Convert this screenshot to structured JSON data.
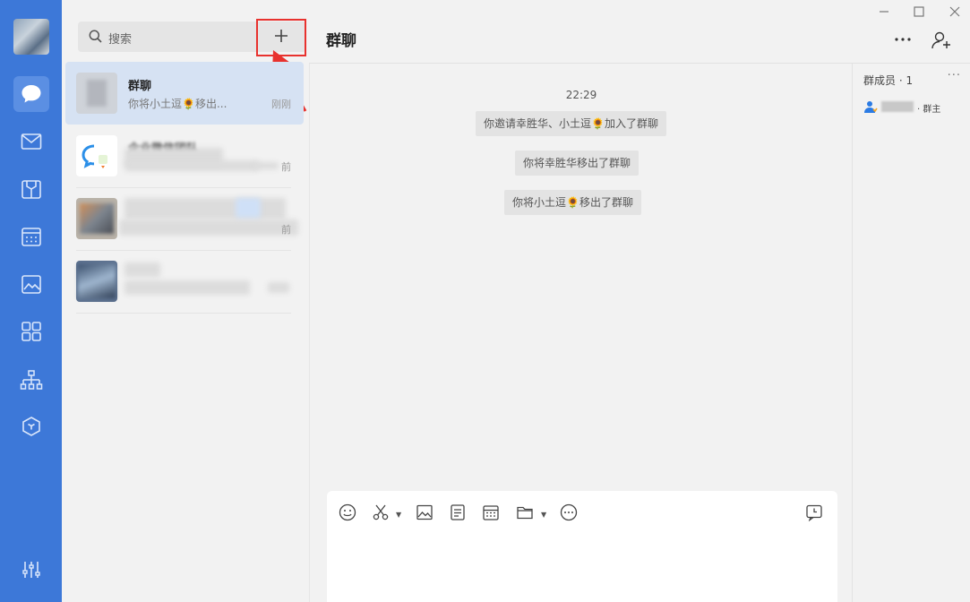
{
  "search": {
    "placeholder": "搜索"
  },
  "chat_list": [
    {
      "name": "群聊",
      "preview": "你将小土逗🌻移出...",
      "time": "刚刚",
      "selected": true
    },
    {
      "name": "企业微信团队",
      "preview": "",
      "time": "前",
      "selected": false
    },
    {
      "name": "",
      "preview": "",
      "time": "前",
      "selected": false
    },
    {
      "name": "",
      "preview": "",
      "time": "",
      "selected": false
    }
  ],
  "chat": {
    "title": "群聊",
    "time": "22:29",
    "messages": [
      "你邀请幸胜华、小土逗🌻加入了群聊",
      "你将幸胜华移出了群聊",
      "你将小土逗🌻移出了群聊"
    ]
  },
  "members": {
    "title": "群成员 · 1",
    "owner_role": "· 群主"
  },
  "colors": {
    "rail": "#3d78d8",
    "selected_item": "#d6e2f3",
    "highlight": "#e8322e"
  },
  "icons": [
    "chat-icon",
    "mail-icon",
    "docs-icon",
    "calendar-icon",
    "drive-icon",
    "apps-icon",
    "org-icon",
    "cube-icon",
    "settings-icon"
  ]
}
